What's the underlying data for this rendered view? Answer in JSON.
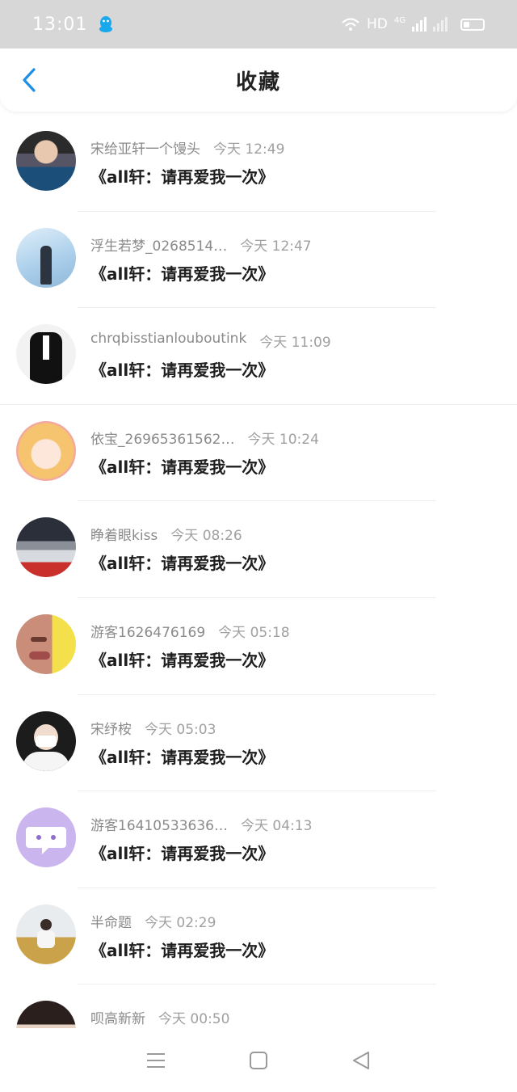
{
  "status_bar": {
    "time": "13:01",
    "network_label": "HD",
    "network_type": "4G"
  },
  "header": {
    "title": "收藏",
    "back_icon": "chevron-left-icon",
    "accent_color": "#1e8fe6"
  },
  "items": [
    {
      "name": "宋给亚轩一个馒头",
      "time": "今天 12:49",
      "title": "《all轩：请再爱我一次》",
      "avatar_style": "photo-boy"
    },
    {
      "name": "浮生若梦_0268514…",
      "time": "今天 12:47",
      "title": "《all轩：请再爱我一次》",
      "avatar_style": "sky-silhouette"
    },
    {
      "name": "chrqbisstianlouboutink",
      "time": "今天 11:09",
      "title": "《all轩：请再爱我一次》",
      "avatar_style": "black-suit"
    },
    {
      "name": "依宝_26965361562…",
      "time": "今天 10:24",
      "title": "《all轩：请再爱我一次》",
      "avatar_style": "anime-girl"
    },
    {
      "name": "睁着眼kiss",
      "time": "今天 08:26",
      "title": "《all轩：请再爱我一次》",
      "avatar_style": "group-photo"
    },
    {
      "name": "游客1626476169",
      "time": "今天 05:18",
      "title": "《all轩：请再爱我一次》",
      "avatar_style": "face-closeup"
    },
    {
      "name": "宋纾桉",
      "time": "今天 05:03",
      "title": "《all轩：请再爱我一次》",
      "avatar_style": "masked-boy"
    },
    {
      "name": "游客16410533636…",
      "time": "今天 04:13",
      "title": "《all轩：请再爱我一次》",
      "avatar_style": "default-chat"
    },
    {
      "name": "半命题",
      "time": "今天 02:29",
      "title": "《all轩：请再爱我一次》",
      "avatar_style": "outdoor-person"
    },
    {
      "name": "呗高新新",
      "time": "今天 00:50",
      "title": "",
      "avatar_style": "dark-hair"
    }
  ],
  "nav_bar": {
    "menu_icon": "menu-icon",
    "home_icon": "square-home-icon",
    "back_icon": "triangle-back-icon"
  }
}
